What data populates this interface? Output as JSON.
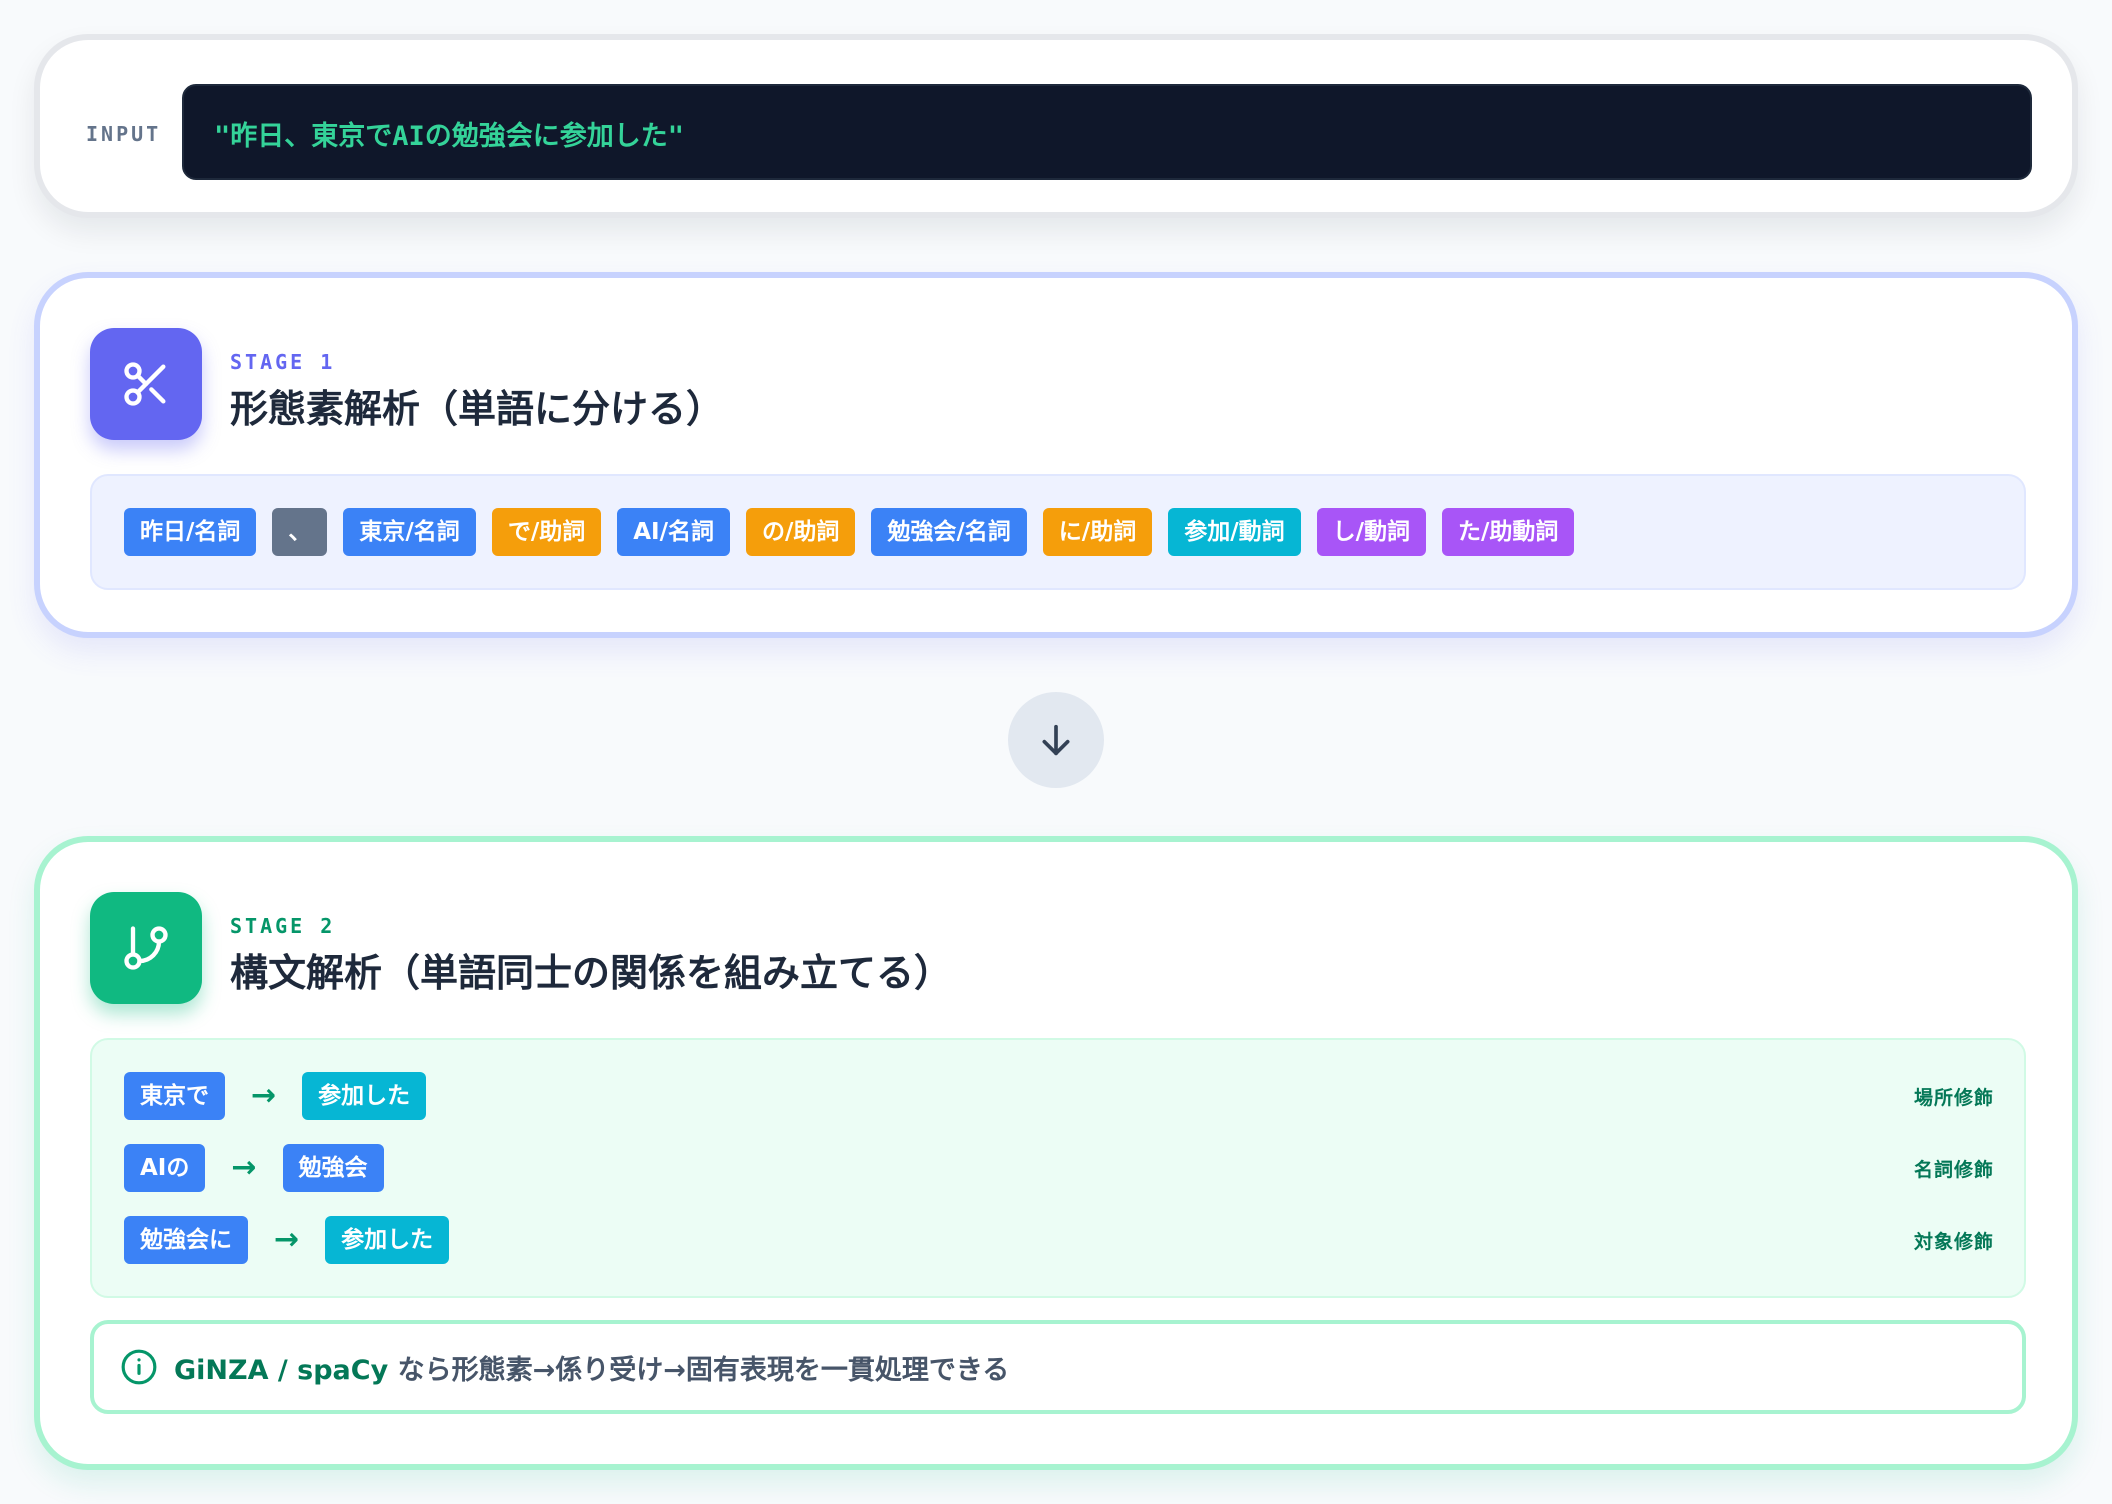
{
  "input": {
    "label": "INPUT",
    "text": "\"昨日、東京でAIの勉強会に参加した\""
  },
  "stage1": {
    "icon": "scissors-icon",
    "label": "STAGE 1",
    "title": "形態素解析（単語に分ける）",
    "tokens": [
      {
        "text": "昨日/名詞",
        "type": "noun"
      },
      {
        "text": "、",
        "type": "punct"
      },
      {
        "text": "東京/名詞",
        "type": "noun"
      },
      {
        "text": "で/助詞",
        "type": "particle"
      },
      {
        "text": "AI/名詞",
        "type": "noun"
      },
      {
        "text": "の/助詞",
        "type": "particle"
      },
      {
        "text": "勉強会/名詞",
        "type": "noun"
      },
      {
        "text": "に/助詞",
        "type": "particle"
      },
      {
        "text": "参加/動詞",
        "type": "verb"
      },
      {
        "text": "し/動詞",
        "type": "aux"
      },
      {
        "text": "た/助動詞",
        "type": "aux"
      }
    ],
    "colors": {
      "noun": "#3b82f6",
      "punct": "#64748b",
      "particle": "#f59e0b",
      "verb": "#06b6d4",
      "aux": "#a855f7"
    }
  },
  "connector": {
    "icon": "arrow-down-icon"
  },
  "stage2": {
    "icon": "git-branch-icon",
    "label": "STAGE 2",
    "title": "構文解析（単語同士の関係を組み立てる）",
    "dependencies": [
      {
        "source": "東京で",
        "target": "参加した",
        "relation": "場所修飾"
      },
      {
        "source": "AIの",
        "target": "勉強会",
        "relation": "名詞修飾"
      },
      {
        "source": "勉強会に",
        "target": "参加した",
        "relation": "対象修飾"
      }
    ],
    "arrow": "→",
    "note": {
      "icon": "info-icon",
      "strong": "GiNZA / spaCy",
      "text": " なら形態素→係り受け→固有表現を一貫処理できる"
    }
  }
}
